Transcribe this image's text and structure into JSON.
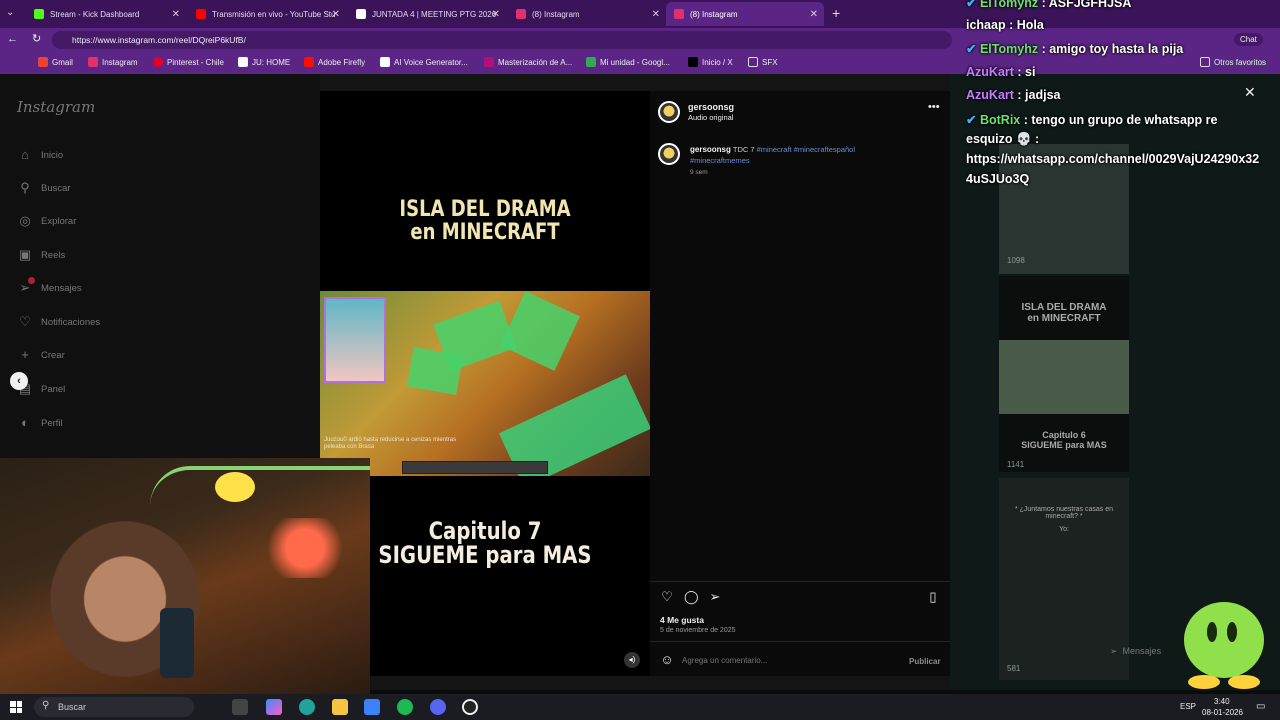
{
  "browser": {
    "tabs": [
      {
        "label": "Stream - Kick Dashboard",
        "color": "#53fc18"
      },
      {
        "label": "Transmisión en vivo - YouTube Stu",
        "color": "#ff0000"
      },
      {
        "label": "JUNTADA 4 | MEETING PTG 2026",
        "color": "#ffffff"
      },
      {
        "label": "(8) Instagram",
        "color": "#e1306c"
      },
      {
        "label": "(8) Instagram",
        "color": "#e1306c"
      }
    ],
    "url": "https://www.instagram.com/reel/DQreiP6kUfB/",
    "chat_button": "Chat",
    "bookmarks": [
      "Gmail",
      "Instagram",
      "Pinterest - Chile",
      "JU: HOME",
      "Adobe Firefly",
      "AI Voice Generator...",
      "Masterización de A...",
      "Mi unidad - Googl...",
      "Inicio / X",
      "SFX"
    ],
    "other_favorites": "Otros favoritos"
  },
  "instagram": {
    "logo": "Instagram",
    "nav": [
      {
        "label": "Inicio",
        "icon": "home-icon"
      },
      {
        "label": "Buscar",
        "icon": "search-icon"
      },
      {
        "label": "Explorar",
        "icon": "compass-icon"
      },
      {
        "label": "Reels",
        "icon": "reels-icon"
      },
      {
        "label": "Mensajes",
        "icon": "messenger-icon"
      },
      {
        "label": "Notificaciones",
        "icon": "heart-icon"
      },
      {
        "label": "Crear",
        "icon": "plus-icon"
      },
      {
        "label": "Panel",
        "icon": "dashboard-icon"
      },
      {
        "label": "Perfil",
        "icon": "profile-icon"
      }
    ],
    "reel": {
      "title_line1": "ISLA DEL DRAMA",
      "title_line2": "en MINECRAFT",
      "sub_line1": "Capitulo 7",
      "sub_line2": "SIGUEME para MAS",
      "game_chat": "Juuzou0 ardió hasta reducirse a cenizas mientras peleaba con Brasa"
    },
    "post": {
      "username": "gersoonsg",
      "audio": "Audio original",
      "caption_user": "gersoonsg",
      "caption_text": "TDC 7",
      "hashtags": "#minecraft #minecraftespañol",
      "hashtags2": "#minecraftmemes",
      "age": "9 sem",
      "likes": "4 Me gusta",
      "date": "5 de noviembre de 2025",
      "comment_placeholder": "Agrega un comentario...",
      "publish": "Publicar"
    },
    "grid": {
      "views": [
        "1098",
        "1141",
        "581"
      ],
      "tile_title_1": "ISLA DEL DRAMA",
      "tile_title_2": "en MINECRAFT",
      "tile_cap_1": "Capitulo 6",
      "tile_cap_2": "SIGUEME para MAS",
      "tile_quote": "* ¿Juntamos nuestras casas en minecraft? *",
      "tile_quote_2": "Yo:",
      "messages": "Mensajes"
    }
  },
  "stream_chat": [
    {
      "user": "ElTomyhz",
      "text": ": ASFJGFHJSA",
      "user_color": "#6ee06e"
    },
    {
      "user": "ichaap",
      "text": ": Hola",
      "user_color": "#ffffff"
    },
    {
      "user": "ElTomyhz",
      "text": ": amigo toy hasta la pija",
      "user_color": "#6ee06e"
    },
    {
      "user": "AzuKart",
      "text": ": si",
      "user_color": "#c77dff"
    },
    {
      "user": "AzuKart",
      "text": ": jadjsa",
      "user_color": "#c77dff"
    },
    {
      "user": "BotRix",
      "text": ": tengo un grupo de whatsapp re",
      "user_color": "#6ee06e"
    }
  ],
  "stream_chat_cont": [
    "esquizo 💀 :",
    "https://whatsapp.com/channel/0029VajU24290x32",
    "4uSJUo3Q"
  ],
  "taskbar": {
    "search": "Buscar",
    "lang": "ESP",
    "time": "3:40",
    "date": "08-01-2026"
  }
}
